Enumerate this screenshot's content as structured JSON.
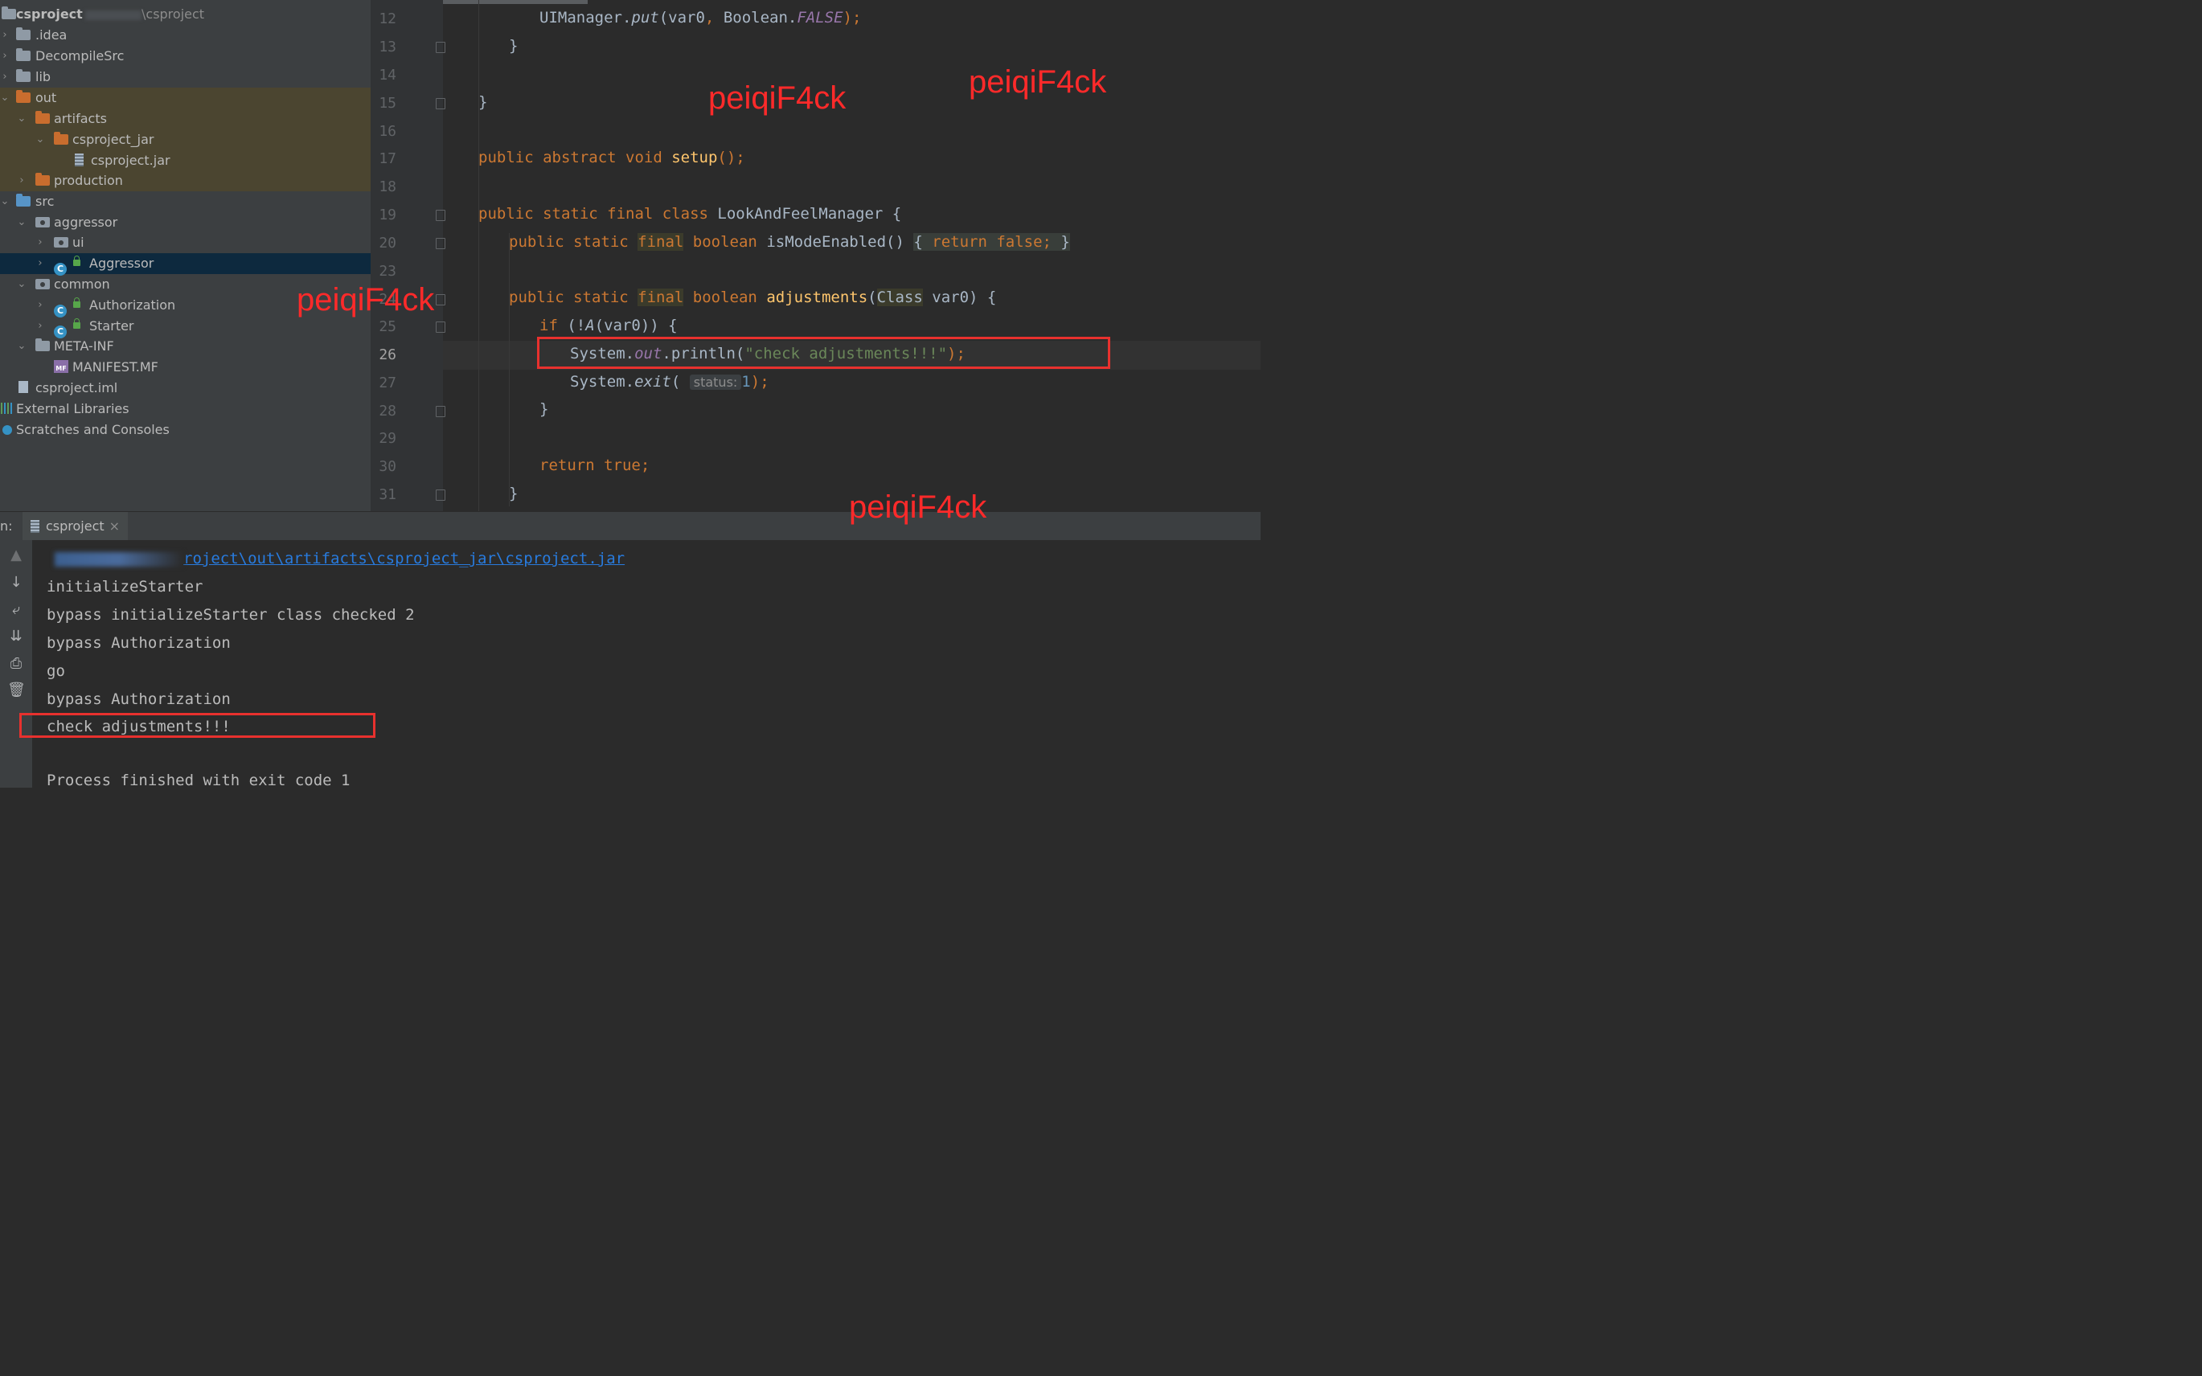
{
  "project_tree": {
    "root_name": "csproject",
    "root_path": "\\csproject",
    "items": [
      {
        "label": ".idea",
        "icon": "folder-icon"
      },
      {
        "label": "DecompileSrc",
        "icon": "folder-icon"
      },
      {
        "label": "lib",
        "icon": "folder-icon"
      },
      {
        "label": "out",
        "icon": "folder-orange-icon"
      },
      {
        "label": "artifacts",
        "icon": "folder-orange-icon"
      },
      {
        "label": "csproject_jar",
        "icon": "folder-orange-icon"
      },
      {
        "label": "csproject.jar",
        "icon": "jar-icon"
      },
      {
        "label": "production",
        "icon": "folder-orange-icon"
      },
      {
        "label": "src",
        "icon": "source-folder-icon"
      },
      {
        "label": "aggressor",
        "icon": "package-icon"
      },
      {
        "label": "ui",
        "icon": "package-icon"
      },
      {
        "label": "Aggressor",
        "icon": "class-icon"
      },
      {
        "label": "common",
        "icon": "package-icon"
      },
      {
        "label": "Authorization",
        "icon": "class-icon"
      },
      {
        "label": "Starter",
        "icon": "class-icon"
      },
      {
        "label": "META-INF",
        "icon": "folder-icon"
      },
      {
        "label": "MANIFEST.MF",
        "icon": "manifest-icon"
      },
      {
        "label": "csproject.iml",
        "icon": "iml-icon"
      },
      {
        "label": "External Libraries",
        "icon": "libraries-icon"
      },
      {
        "label": "Scratches and Consoles",
        "icon": "scratches-icon"
      }
    ]
  },
  "editor": {
    "line_numbers": [
      "12",
      "13",
      "14",
      "15",
      "16",
      "17",
      "18",
      "19",
      "20",
      "23",
      "24",
      "25",
      "26",
      "27",
      "28",
      "29",
      "30",
      "31"
    ],
    "current_line": "26",
    "code": {
      "l12_a": "UIManager.",
      "l12_b": "put",
      "l12_c": "(var0",
      "l12_d": ", ",
      "l12_e": "Boolean.",
      "l12_f": "FALSE",
      "l12_g": ");",
      "l13": "}",
      "l15": "}",
      "l17_a": "public abstract void ",
      "l17_b": "setup",
      "l17_c": "();",
      "l19_a": "public static final class ",
      "l19_b": "LookAndFeelManager {",
      "l20_a": "public static ",
      "l20_b": "final",
      "l20_c": " boolean ",
      "l20_d": "isModeEnabled",
      "l20_e": "() ",
      "l20_f": "{ ",
      "l20_g": "return false;",
      "l20_h": " }",
      "l24_a": "public static ",
      "l24_b": "final",
      "l24_c": " boolean ",
      "l24_d": "adjustments",
      "l24_e": "(",
      "l24_f": "Class",
      "l24_g": " var0) {",
      "l25_a": "if ",
      "l25_b": "(!",
      "l25_c": "A",
      "l25_d": "(var0)) {",
      "l26_a": "System.",
      "l26_b": "out",
      "l26_c": ".println(",
      "l26_d": "\"check adjustments!!!\"",
      "l26_e": ");",
      "l27_a": "System.",
      "l27_b": "exit",
      "l27_c": "( ",
      "l27_hint": "status:",
      "l27_d": "1",
      "l27_e": ");",
      "l28": "}",
      "l30_a": "return ",
      "l30_b": "true",
      "l30_c": ";",
      "l31": "}"
    }
  },
  "run_panel": {
    "label": "n:",
    "tab_label": "csproject",
    "tab_close": "×",
    "toolbar_icons": [
      "up-icon",
      "down-icon",
      "soft-wrap-icon",
      "scroll-to-end-icon",
      "print-icon",
      "trash-icon"
    ],
    "path_text": "roject\\out\\artifacts\\csproject_jar\\csproject.jar",
    "lines": [
      "initializeStarter",
      "bypass initializeStarter class checked 2",
      "bypass Authorization",
      "go",
      "bypass Authorization",
      "check adjustments!!!",
      "",
      "Process finished with exit code 1"
    ]
  },
  "watermarks": [
    "peiqiF4ck",
    "peiqiF4ck",
    "peiqiF4ck",
    "peiqiF4ck"
  ],
  "colors": {
    "watermark": "#ff2a2a",
    "highlight_box": "#e8312e",
    "keyword": "#cc7832",
    "string": "#6a8759",
    "function": "#ffc66d"
  }
}
